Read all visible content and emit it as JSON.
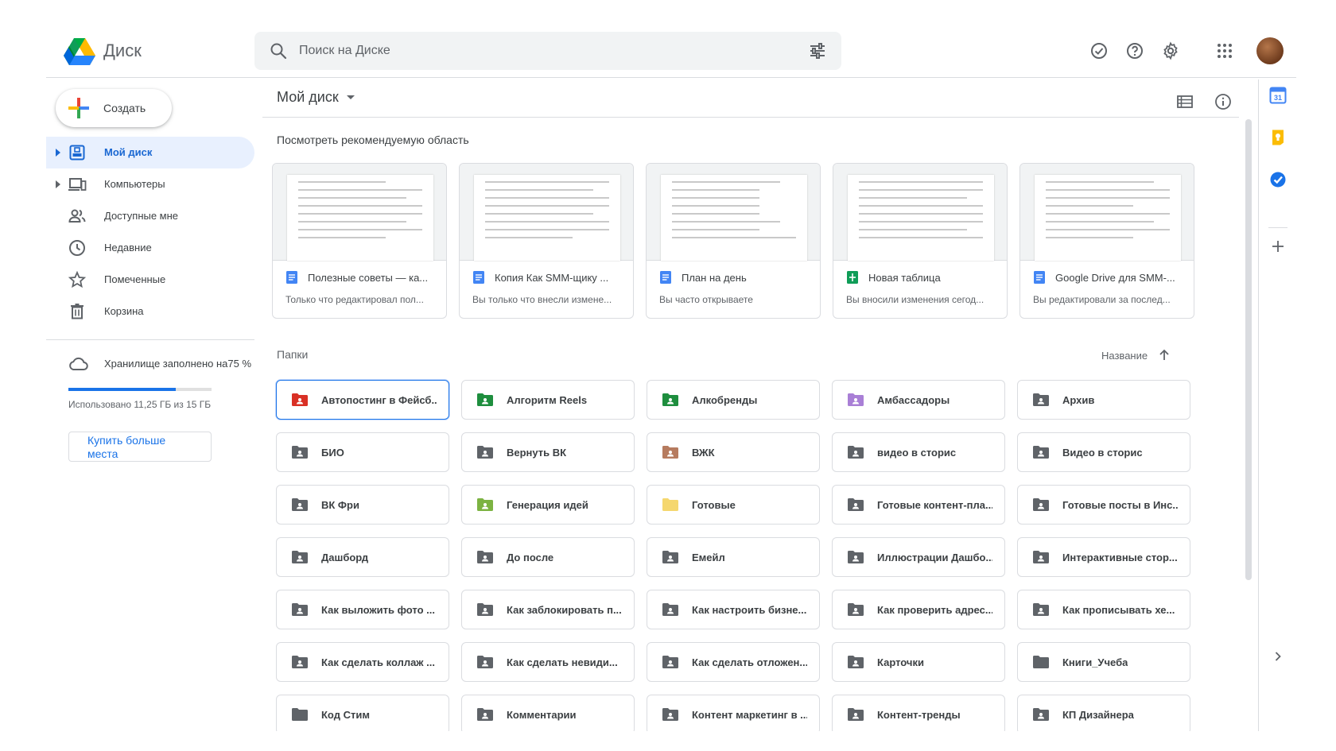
{
  "app": {
    "name": "Диск"
  },
  "search": {
    "placeholder": "Поиск на Диске"
  },
  "nav": {
    "create_label": "Создать",
    "items": [
      {
        "label": "Мой диск",
        "icon": "my-drive-icon",
        "active": true
      },
      {
        "label": "Компьютеры",
        "icon": "computers-icon"
      },
      {
        "label": "Доступные мне",
        "icon": "shared-icon"
      },
      {
        "label": "Недавние",
        "icon": "clock-icon"
      },
      {
        "label": "Помеченные",
        "icon": "star-icon"
      },
      {
        "label": "Корзина",
        "icon": "trash-icon"
      }
    ]
  },
  "storage": {
    "title": "Хранилище заполнено на75 %",
    "used_text": "Использовано 11,25 ГБ из 15 ГБ",
    "percent": 75,
    "buy_label": "Купить больше места"
  },
  "main": {
    "title": "Мой диск",
    "suggested_title": "Посмотреть рекомендуемую область",
    "folders_title": "Папки",
    "sort_label": "Название"
  },
  "suggested": [
    {
      "title": "Полезные советы — ка...",
      "subtitle": "Только что редактировал пол...",
      "type": "doc"
    },
    {
      "title": "Копия Как SMM-щику ...",
      "subtitle": "Вы только что внесли измене...",
      "type": "doc"
    },
    {
      "title": "План на день",
      "subtitle": "Вы часто открываете",
      "type": "doc"
    },
    {
      "title": "Новая таблица",
      "subtitle": "Вы вносили изменения сегод...",
      "type": "sheet"
    },
    {
      "title": "Google Drive для SMM-...",
      "subtitle": "Вы редактировали за послед...",
      "type": "doc"
    }
  ],
  "folders": [
    {
      "name": "Автопостинг в Фейсб...",
      "color": "#d93025",
      "shared": true,
      "selected": true
    },
    {
      "name": "Алгоритм Reels",
      "color": "#1e8e3e",
      "shared": true
    },
    {
      "name": "Алкобренды",
      "color": "#1e8e3e",
      "shared": true
    },
    {
      "name": "Амбассадоры",
      "color": "#a97fd6",
      "shared": true
    },
    {
      "name": "Архив",
      "color": "#5f6368",
      "shared": true
    },
    {
      "name": "БИО",
      "color": "#5f6368",
      "shared": true
    },
    {
      "name": "Вернуть ВК",
      "color": "#5f6368",
      "shared": true
    },
    {
      "name": "ВЖК",
      "color": "#b67b5f",
      "shared": true
    },
    {
      "name": "видео в сторис",
      "color": "#5f6368",
      "shared": true
    },
    {
      "name": "Видео в сторис",
      "color": "#5f6368",
      "shared": true
    },
    {
      "name": "ВК Фри",
      "color": "#5f6368",
      "shared": true
    },
    {
      "name": "Генерация идей",
      "color": "#7cb342",
      "shared": true
    },
    {
      "name": "Готовые",
      "color": "#f5d76e",
      "shared": false
    },
    {
      "name": "Готовые контент-пла...",
      "color": "#5f6368",
      "shared": true
    },
    {
      "name": "Готовые посты в Инс...",
      "color": "#5f6368",
      "shared": true
    },
    {
      "name": "Дашборд",
      "color": "#5f6368",
      "shared": true
    },
    {
      "name": "До после",
      "color": "#5f6368",
      "shared": true
    },
    {
      "name": "Емейл",
      "color": "#5f6368",
      "shared": true
    },
    {
      "name": "Иллюстрации Дашбо...",
      "color": "#5f6368",
      "shared": true
    },
    {
      "name": "Интерактивные стор...",
      "color": "#5f6368",
      "shared": true
    },
    {
      "name": "Как выложить фото ...",
      "color": "#5f6368",
      "shared": true
    },
    {
      "name": "Как заблокировать п...",
      "color": "#5f6368",
      "shared": true
    },
    {
      "name": "Как настроить бизне...",
      "color": "#5f6368",
      "shared": true
    },
    {
      "name": "Как проверить адрес...",
      "color": "#5f6368",
      "shared": true
    },
    {
      "name": "Как прописывать хе...",
      "color": "#5f6368",
      "shared": true
    },
    {
      "name": "Как сделать коллаж ...",
      "color": "#5f6368",
      "shared": true
    },
    {
      "name": "Как сделать невиди...",
      "color": "#5f6368",
      "shared": true
    },
    {
      "name": "Как сделать отложен...",
      "color": "#5f6368",
      "shared": true
    },
    {
      "name": "Карточки",
      "color": "#5f6368",
      "shared": true
    },
    {
      "name": "Книги_Учеба",
      "color": "#5f6368",
      "shared": false
    },
    {
      "name": "Код Стим",
      "color": "#5f6368",
      "shared": false
    },
    {
      "name": "Комментарии",
      "color": "#5f6368",
      "shared": true
    },
    {
      "name": "Контент маркетинг в ...",
      "color": "#5f6368",
      "shared": true
    },
    {
      "name": "Контент-тренды",
      "color": "#5f6368",
      "shared": true
    },
    {
      "name": "КП Дизайнера",
      "color": "#5f6368",
      "shared": true
    }
  ],
  "right_panel": {
    "calendar_day": "31",
    "icons": [
      "calendar-icon",
      "keep-icon",
      "tasks-icon",
      "add-addon-icon",
      "expand-panel-icon"
    ]
  },
  "colors": {
    "accent": "#1a73e8",
    "active_bg": "#e8f0fe"
  }
}
